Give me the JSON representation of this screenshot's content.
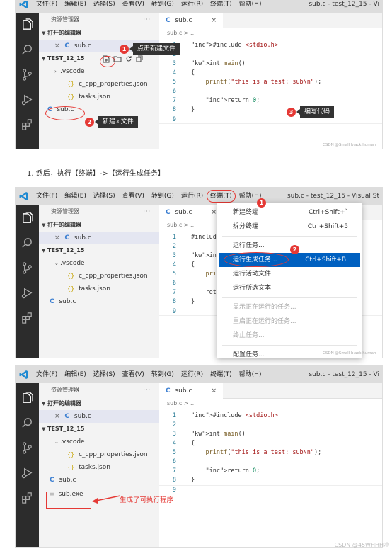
{
  "menu": {
    "file": "文件(F)",
    "edit": "编辑(E)",
    "selection": "选择(S)",
    "view": "查看(V)",
    "goto": "转到(G)",
    "run": "运行(R)",
    "terminal": "终端(T)",
    "help": "帮助(H)"
  },
  "window_titles": {
    "shot1": "sub.c - test_12_15 - Vi",
    "shot2": "sub.c - test_12_15 - Visual St",
    "shot3": "sub.c - test_12_15 - Vi"
  },
  "explorer": {
    "title": "资源管理器",
    "more": "···",
    "open_editors": "打开的编辑器",
    "folder": "TEST_12_15",
    "vscode": ".vscode",
    "cpp_props": "c_cpp_properties.json",
    "tasks": "tasks.json",
    "sub_c": "sub.c",
    "sub_exe": "sub.exe",
    "close_glyph": "×",
    "c_glyph": "C",
    "json_glyph": "{}"
  },
  "tab": {
    "label": "sub.c",
    "close": "×"
  },
  "breadcrumb": "sub.c > ...",
  "code": [
    {
      "n": "1",
      "t": "#include <stdio.h>"
    },
    {
      "n": "2",
      "t": ""
    },
    {
      "n": "3",
      "t": "int main()"
    },
    {
      "n": "4",
      "t": "{"
    },
    {
      "n": "5",
      "t": "    printf(\"this is a test: sub\\n\");"
    },
    {
      "n": "6",
      "t": ""
    },
    {
      "n": "7",
      "t": "    return 0;"
    },
    {
      "n": "8",
      "t": "}"
    },
    {
      "n": "9",
      "t": ""
    }
  ],
  "code_short": [
    {
      "n": "1",
      "t": "#include"
    },
    {
      "n": "2",
      "t": ""
    },
    {
      "n": "3",
      "t": "int main("
    },
    {
      "n": "4",
      "t": "{"
    },
    {
      "n": "5",
      "t": "    print"
    },
    {
      "n": "6",
      "t": ""
    },
    {
      "n": "7",
      "t": "    retur"
    },
    {
      "n": "8",
      "t": "}"
    },
    {
      "n": "9",
      "t": ""
    }
  ],
  "annotations": {
    "new_file": "点击新建文件",
    "new_c": "新建.c文件",
    "write_code": "编写代码",
    "badge1": "1",
    "badge2": "2",
    "badge3": "3",
    "exe_created": "生成了可执行程序"
  },
  "step_text": "1. 然后，执行【终端】->【运行生成任务】",
  "terminal_menu": [
    {
      "label": "新建终端",
      "shortcut": "Ctrl+Shift+`",
      "disabled": false
    },
    {
      "label": "拆分终端",
      "shortcut": "Ctrl+Shift+5",
      "disabled": false
    },
    {
      "label": "运行任务...",
      "shortcut": "",
      "disabled": false
    },
    {
      "label": "运行生成任务...",
      "shortcut": "Ctrl+Shift+B",
      "disabled": false
    },
    {
      "label": "运行活动文件",
      "shortcut": "",
      "disabled": false
    },
    {
      "label": "运行所选文本",
      "shortcut": "",
      "disabled": false
    },
    {
      "label": "显示正在运行的任务...",
      "shortcut": "",
      "disabled": true
    },
    {
      "label": "重启正在运行的任务...",
      "shortcut": "",
      "disabled": true
    },
    {
      "label": "终止任务...",
      "shortcut": "",
      "disabled": true
    },
    {
      "label": "配置任务...",
      "shortcut": "",
      "disabled": false
    }
  ],
  "watermark_small": "CSDN @Small black human",
  "watermark_footer": "CSDN @45WHHH冲"
}
